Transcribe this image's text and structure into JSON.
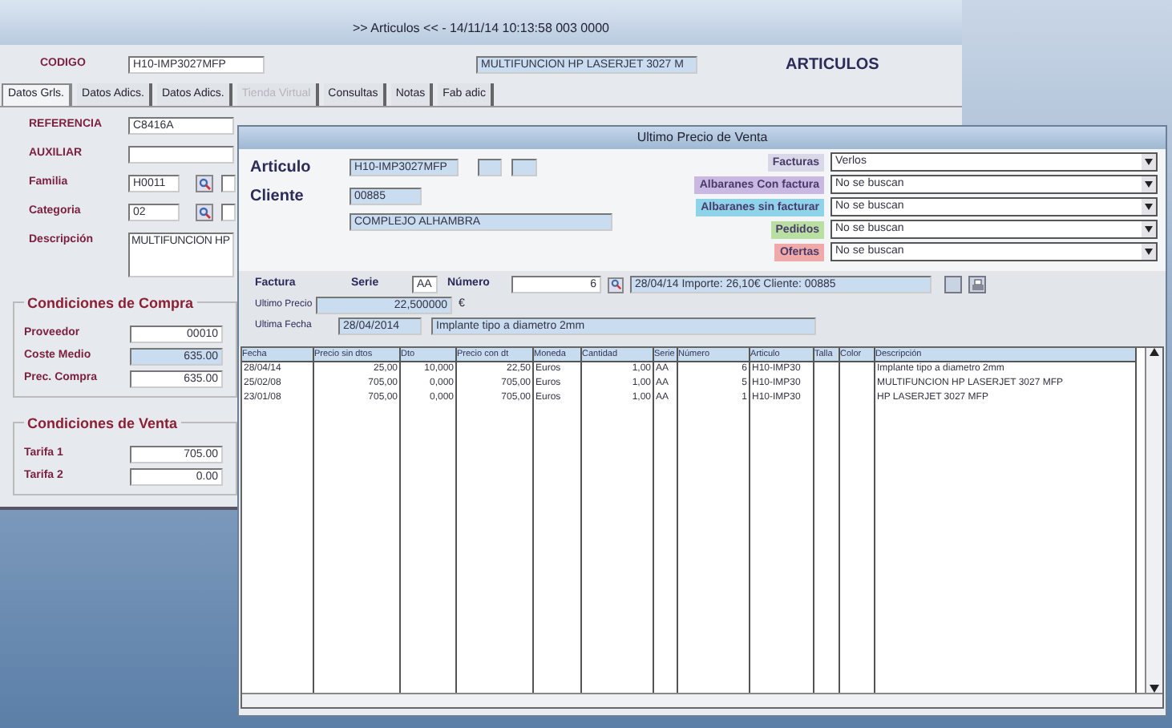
{
  "main_window": {
    "title": ">> Articulos << - 14/11/14 10:13:58 003 0000",
    "heading": "ARTICULOS",
    "codigo": {
      "label": "CODIGO",
      "value": "H10-IMP3027MFP",
      "description": "MULTIFUNCION HP LASERJET 3027 M"
    },
    "tabs": [
      {
        "label": "Datos Grls.",
        "selected": true,
        "disabled": false
      },
      {
        "label": "Datos Adics.",
        "selected": false,
        "disabled": false
      },
      {
        "label": "Datos Adics.",
        "selected": false,
        "disabled": false
      },
      {
        "label": "Tienda Virtual",
        "selected": false,
        "disabled": true
      },
      {
        "label": "Consultas",
        "selected": false,
        "disabled": false
      },
      {
        "label": "Notas",
        "selected": false,
        "disabled": false
      },
      {
        "label": "Fab adic",
        "selected": false,
        "disabled": false
      }
    ],
    "fields": [
      {
        "kind": "text",
        "label": "REFERENCIA",
        "value": "C8416A"
      },
      {
        "kind": "text",
        "label": "AUXILIAR"
      },
      {
        "kind": "lookup",
        "label": "Familia",
        "value": "H0011"
      },
      {
        "kind": "lookup",
        "label": "Categoria",
        "value": "02"
      },
      {
        "kind": "textarea",
        "label": "Descripción",
        "value": "MULTIFUNCION HP"
      }
    ],
    "compra": {
      "title": "Condiciones de Compra",
      "rows": [
        {
          "label": "Proveedor",
          "value": "00010",
          "readonly": false
        },
        {
          "label": "Coste Medio",
          "value": "635.00",
          "readonly": true
        },
        {
          "label": "Prec. Compra",
          "value": "635.00",
          "readonly": false
        }
      ]
    },
    "venta": {
      "title": "Condiciones de Venta",
      "rows": [
        {
          "label": "Tarifa 1",
          "value": "705.00",
          "readonly": false
        },
        {
          "label": "Tarifa 2",
          "value": "0.00",
          "readonly": false
        }
      ]
    }
  },
  "dialog": {
    "title": "Ultimo Precio de Venta",
    "articulo": {
      "label": "Articulo",
      "value": "H10-IMP3027MFP"
    },
    "cliente": {
      "label": "Cliente",
      "value": "00885",
      "name": "COMPLEJO ALHAMBRA"
    },
    "filters": [
      {
        "label": "Facturas",
        "value": "Verlos",
        "color": "#d9d8e8"
      },
      {
        "label": "Albaranes Con factura",
        "value": "No se buscan",
        "color": "#c9b8e2"
      },
      {
        "label": "Albaranes sin facturar",
        "value": "No se buscan",
        "color": "#8fd3ea"
      },
      {
        "label": "Pedidos",
        "value": "No se buscan",
        "color": "#b9e0a2"
      },
      {
        "label": "Ofertas",
        "value": "No se buscan",
        "color": "#f0a9a9"
      }
    ],
    "factura": {
      "label": "Factura",
      "serie_label": "Serie",
      "serie": "AA",
      "numero_label": "Número",
      "numero": "6",
      "info": "28/04/14 Importe: 26,10€ Cliente: 00885"
    },
    "ultimo_precio": {
      "label": "Ultimo Precio",
      "value": "22,500000",
      "unit": "€"
    },
    "ultima_fecha": {
      "label": "Ultima Fecha",
      "value": "28/04/2014",
      "note": "Implante tipo a diametro 2mm"
    },
    "table": {
      "columns": [
        "Fecha",
        "Precio sin dtos",
        "Dto",
        "Precio con dt",
        "Moneda",
        "Cantidad",
        "Serie",
        "Número",
        "Articulo",
        "Talla",
        "Color",
        "Descripción"
      ],
      "rows": [
        [
          "28/04/14",
          "25,00",
          "10,000",
          "22,50",
          "Euros",
          "1,00",
          "AA",
          "6",
          "H10-IMP30",
          "",
          "",
          "Implante tipo a diametro 2mm"
        ],
        [
          "25/02/08",
          "705,00",
          "0,000",
          "705,00",
          "Euros",
          "1,00",
          "AA",
          "5",
          "H10-IMP30",
          "",
          "",
          "MULTIFUNCION HP LASERJET 3027 MFP"
        ],
        [
          "23/01/08",
          "705,00",
          "0,000",
          "705,00",
          "Euros",
          "1,00",
          "AA",
          "1",
          "H10-IMP30",
          "",
          "",
          "HP LASERJET 3027 MFP"
        ]
      ]
    }
  }
}
